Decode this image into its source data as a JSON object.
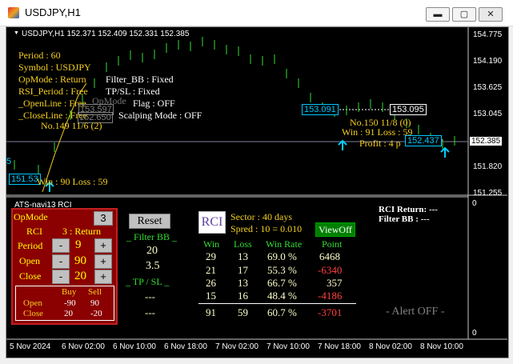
{
  "window": {
    "title": "USDJPY,H1",
    "btn_min": "▬",
    "btn_max": "▢",
    "btn_close": "✕"
  },
  "chart_header": {
    "arrow": "▼",
    "text": "USDJPY,H1  152.371 152.409 152.331 152.385"
  },
  "price_axis": {
    "ticks": [
      "154.775",
      "154.190",
      "153.625",
      "153.045",
      "152.385",
      "151.820",
      "151.255"
    ],
    "current": "152.385"
  },
  "time_axis": {
    "ticks": [
      "5 Nov 2024",
      "6 Nov 02:00",
      "6 Nov 10:00",
      "6 Nov 18:00",
      "7 Nov 02:00",
      "7 Nov 10:00",
      "7 Nov 18:00",
      "8 Nov 02:00",
      "8 Nov 10:00"
    ]
  },
  "overlay": {
    "period": "Period : 60",
    "symbol": "Symbol : USDJPY",
    "opmode": "OpMode : Return",
    "filter_bb": "Filter_BB : Fixed",
    "rsi_period": "RSI_Period : Free",
    "tp_sl": "TP/SL : Fixed",
    "openline": "_OpenLine : Free",
    "flag": "Flag : OFF",
    "closeline": "_CloseLine : Free",
    "scalping": "Scalping Mode : OFF",
    "no149": "No.149   11/6 (2)",
    "box_a": "153.597",
    "box_b": "152.650",
    "ghost": "OpMode",
    "box_left": "151.53",
    "winloss_left": "Win : 90   Loss : 59",
    "box_153091": "153.091",
    "box_153095": "153.095",
    "no150": "No.150   11/8 (0)",
    "win91": "Win : 91   Loss : 59",
    "profit": "Profit : 4 p",
    "box_152437": "152.437",
    "left_edge": "5"
  },
  "subwindow": {
    "label": "ATS-navi13  RCI",
    "axis_top": "0",
    "axis_bottom": "0",
    "rci_return": "RCI Return: ---",
    "filter_bb": "Filter BB  : ---"
  },
  "rci_panel": {
    "opmode_label": "OpMode",
    "opmode_value": "3",
    "rci_label": "RCI",
    "rci_value": "3 : Return",
    "period_label": "Period",
    "period_value": "9",
    "open_label": "Open",
    "open_value": "90",
    "close_label": "Close",
    "close_value": "20",
    "minus": "-",
    "plus": "+",
    "buy_header": "Buy",
    "sell_header": "Sell",
    "open_row_label": "Open",
    "open_buy": "-90",
    "open_sell": "90",
    "close_row_label": "Close",
    "close_buy": "20",
    "close_sell": "-20"
  },
  "filter_section": {
    "reset_label": "Reset",
    "filter_bb_header": "_ Filter BB _",
    "filter_bb_value1": "20",
    "filter_bb_value2": "3.5",
    "tpsl_header": "_ TP  /  SL _",
    "tpsl_value1": "---",
    "tpsl_value2": "---"
  },
  "stats": {
    "logo_text": "RCI",
    "sector": "Sector : 40 days",
    "spread": "Spred : 10 = 0.010",
    "viewoff_label": "ViewOff",
    "headers": [
      "Win",
      "Loss",
      "Win Rate",
      "Point"
    ],
    "rows": [
      {
        "win": "29",
        "loss": "13",
        "rate": "69.0 %",
        "point": "6468",
        "pos": true
      },
      {
        "win": "21",
        "loss": "17",
        "rate": "55.3 %",
        "point": "-6340",
        "pos": false
      },
      {
        "win": "26",
        "loss": "13",
        "rate": "66.7 %",
        "point": "357",
        "pos": true
      },
      {
        "win": "15",
        "loss": "16",
        "rate": "48.4 %",
        "point": "-4186",
        "pos": false
      }
    ],
    "total": {
      "win": "91",
      "loss": "59",
      "rate": "60.7 %",
      "point": "-3701"
    },
    "alert": "- Alert OFF -"
  }
}
